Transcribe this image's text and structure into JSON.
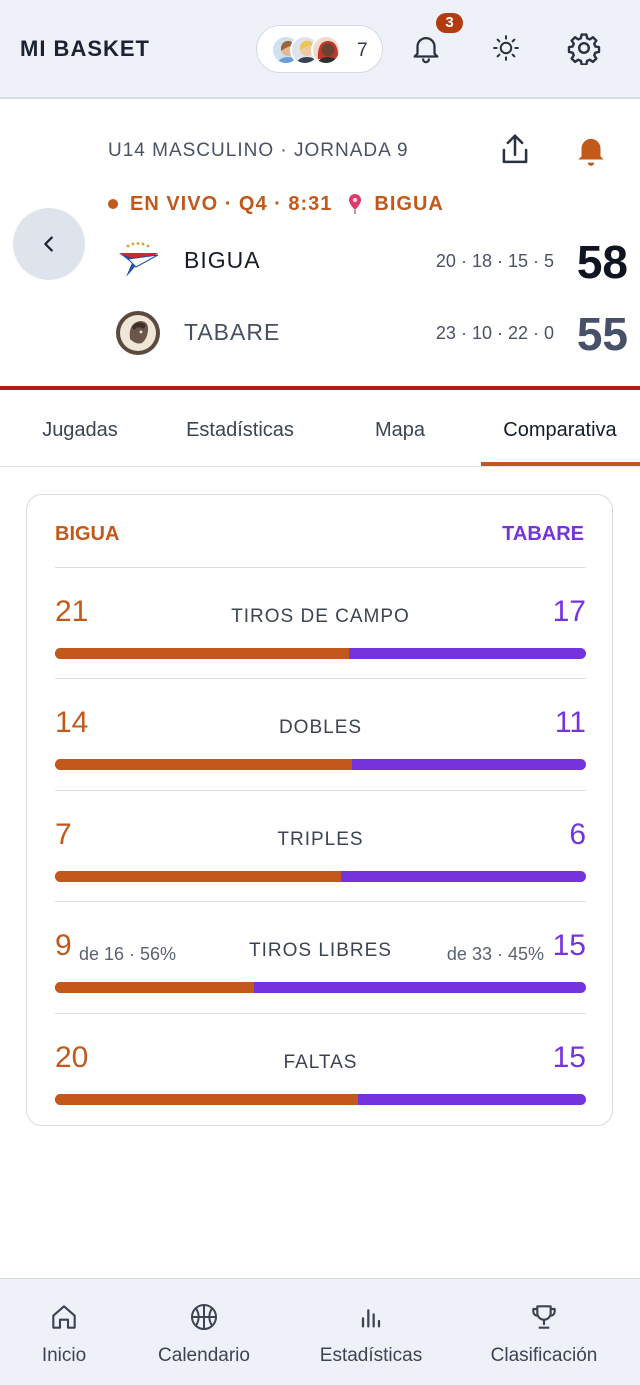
{
  "app": {
    "title": "MI BASKET"
  },
  "topbar": {
    "viewers_count": "7",
    "notifications_badge": "3"
  },
  "match": {
    "league": "U14 MASCULINO · JORNADA 9",
    "status": "EN VIVO · Q4 · 8:31",
    "venue": "BIGUA",
    "home": {
      "name": "BIGUA",
      "quarters": "20 · 18 · 15 · 5",
      "score": "58"
    },
    "away": {
      "name": "TABARE",
      "quarters": "23 · 10 · 22 · 0",
      "score": "55"
    }
  },
  "tabs": [
    "Jugadas",
    "Estadísticas",
    "Mapa",
    "Comparativa"
  ],
  "active_tab": "Comparativa",
  "comparison": {
    "home_label": "BIGUA",
    "away_label": "TABARE",
    "rows": [
      {
        "label": "TIROS DE CAMPO",
        "home": "21",
        "away": "17",
        "home_share": 0.553
      },
      {
        "label": "DOBLES",
        "home": "14",
        "away": "11",
        "home_share": 0.56
      },
      {
        "label": "TRIPLES",
        "home": "7",
        "away": "6",
        "home_share": 0.538
      },
      {
        "label": "TIROS LIBRES",
        "home": "9",
        "away": "15",
        "home_sub": "de 16 · 56%",
        "away_sub": "de 33 · 45%",
        "home_share": 0.375
      },
      {
        "label": "FALTAS",
        "home": "20",
        "away": "15",
        "home_share": 0.571
      }
    ]
  },
  "colors": {
    "home": "#c2581a",
    "away": "#7533dd",
    "live_border": "#b31b1b"
  },
  "bottom_nav": [
    "Inicio",
    "Calendario",
    "Estadísticas",
    "Clasificación"
  ]
}
